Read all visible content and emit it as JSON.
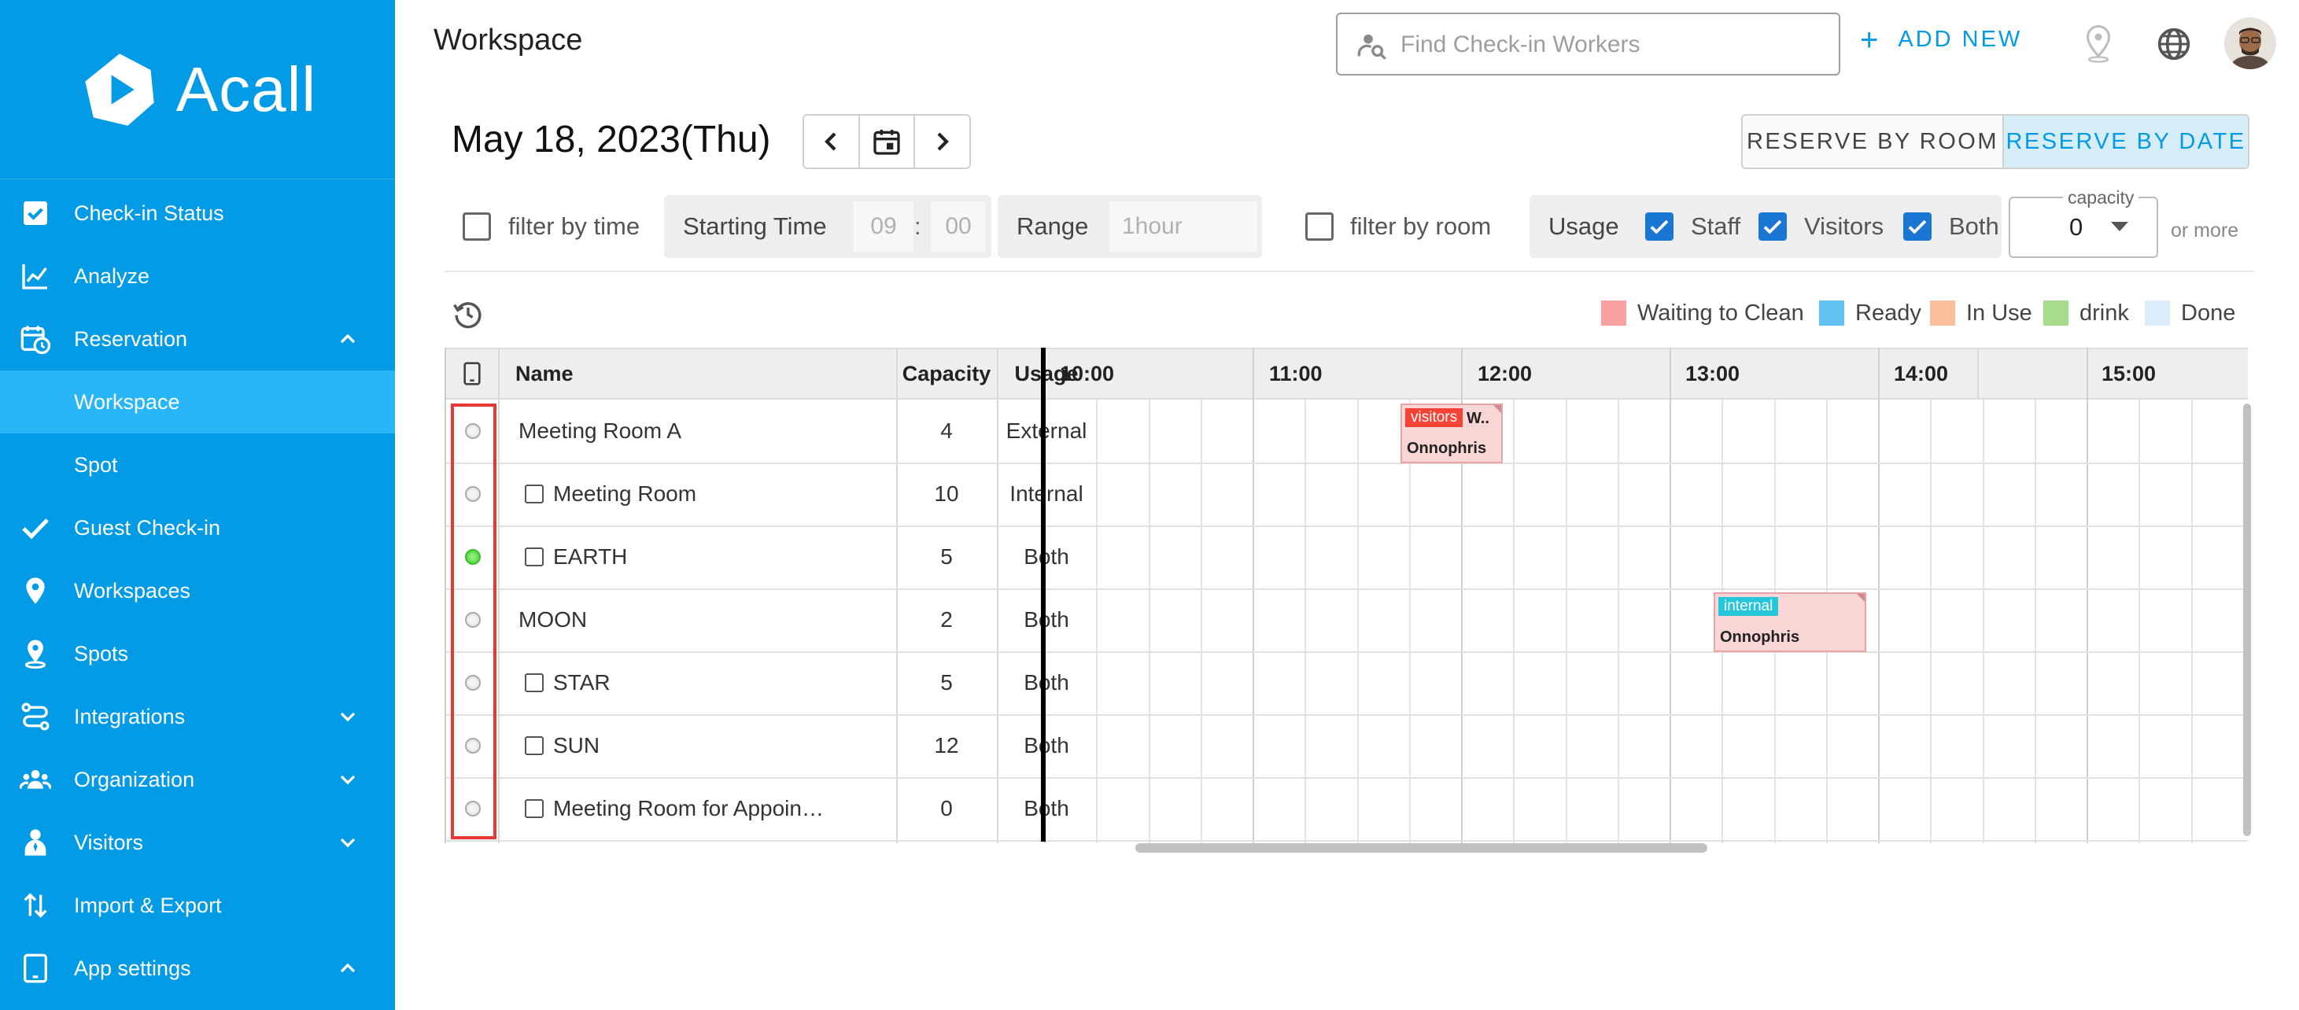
{
  "sidebar": {
    "logo_text": "Acall",
    "items": [
      {
        "label": "Check-in Status",
        "icon": "check-square-icon"
      },
      {
        "label": "Analyze",
        "icon": "chart-line-icon"
      },
      {
        "label": "Reservation",
        "icon": "calendar-clock-icon",
        "expanded": true
      },
      {
        "label": "Workspace",
        "active": true
      },
      {
        "label": "Spot"
      },
      {
        "label": "Guest Check-in",
        "icon": "check-icon"
      },
      {
        "label": "Workspaces",
        "icon": "location-pin-icon"
      },
      {
        "label": "Spots",
        "icon": "location-person-icon"
      },
      {
        "label": "Integrations",
        "icon": "integrations-icon",
        "expanded": false
      },
      {
        "label": "Organization",
        "icon": "people-icon",
        "expanded": false
      },
      {
        "label": "Visitors",
        "icon": "visitor-icon",
        "expanded": false
      },
      {
        "label": "Import & Export",
        "icon": "arrows-updown-icon"
      },
      {
        "label": "App settings",
        "icon": "tablet-icon",
        "expanded": true
      }
    ]
  },
  "header": {
    "title": "Workspace",
    "search_placeholder": "Find Check-in Workers",
    "add_new_label": "ADD NEW"
  },
  "date_bar": {
    "date": "May 18, 2023(Thu)",
    "reserve_by_room": "RESERVE BY ROOM",
    "reserve_by_date": "RESERVE BY DATE",
    "selected_mode": "RESERVE BY DATE"
  },
  "filters": {
    "filter_by_time_label": "filter by time",
    "starting_time_label": "Starting Time",
    "hour_value": "09",
    "separator": ":",
    "minute_value": "00",
    "range_label": "Range",
    "range_value": "1hour",
    "filter_by_room_label": "filter by room",
    "usage_label": "Usage",
    "usage_options": [
      {
        "label": "Staff",
        "checked": true
      },
      {
        "label": "Visitors",
        "checked": true
      },
      {
        "label": "Both",
        "checked": true
      }
    ],
    "capacity_label": "capacity",
    "capacity_value": "0",
    "or_more_label": "or more"
  },
  "legend": [
    {
      "label": "Waiting to Clean",
      "color": "#f7a1a1"
    },
    {
      "label": "Ready",
      "color": "#64c1f3"
    },
    {
      "label": "In Use",
      "color": "#fcbf9c"
    },
    {
      "label": "drink",
      "color": "#a7dc8f"
    },
    {
      "label": "Done",
      "color": "#daedf8"
    }
  ],
  "table": {
    "columns": {
      "name": "Name",
      "capacity": "Capacity",
      "usage": "Usage"
    },
    "times": [
      "10:00",
      "11:00",
      "12:00",
      "13:00",
      "14:00",
      "15:00"
    ],
    "rows": [
      {
        "name": "Meeting Room A",
        "capacity": "4",
        "usage": "External",
        "has_checkbox": false,
        "status_on": false
      },
      {
        "name": "Meeting Room",
        "capacity": "10",
        "usage": "Internal",
        "has_checkbox": true,
        "status_on": false
      },
      {
        "name": "EARTH",
        "capacity": "5",
        "usage": "Both",
        "has_checkbox": true,
        "status_on": true
      },
      {
        "name": "MOON",
        "capacity": "2",
        "usage": "Both",
        "has_checkbox": false,
        "status_on": false
      },
      {
        "name": "STAR",
        "capacity": "5",
        "usage": "Both",
        "has_checkbox": true,
        "status_on": false
      },
      {
        "name": "SUN",
        "capacity": "12",
        "usage": "Both",
        "has_checkbox": true,
        "status_on": false
      },
      {
        "name": "Meeting Room for Appoin…",
        "capacity": "0",
        "usage": "Both",
        "has_checkbox": true,
        "status_on": false
      }
    ],
    "bookings": [
      {
        "room": "Meeting Room A",
        "tag": "visitors",
        "tag_color": "#f44336",
        "extra": "W..",
        "organizer": "Onnophris"
      },
      {
        "room": "MOON",
        "tag": "internal",
        "tag_color": "#26c6da",
        "organizer": "Onnophris"
      }
    ]
  }
}
